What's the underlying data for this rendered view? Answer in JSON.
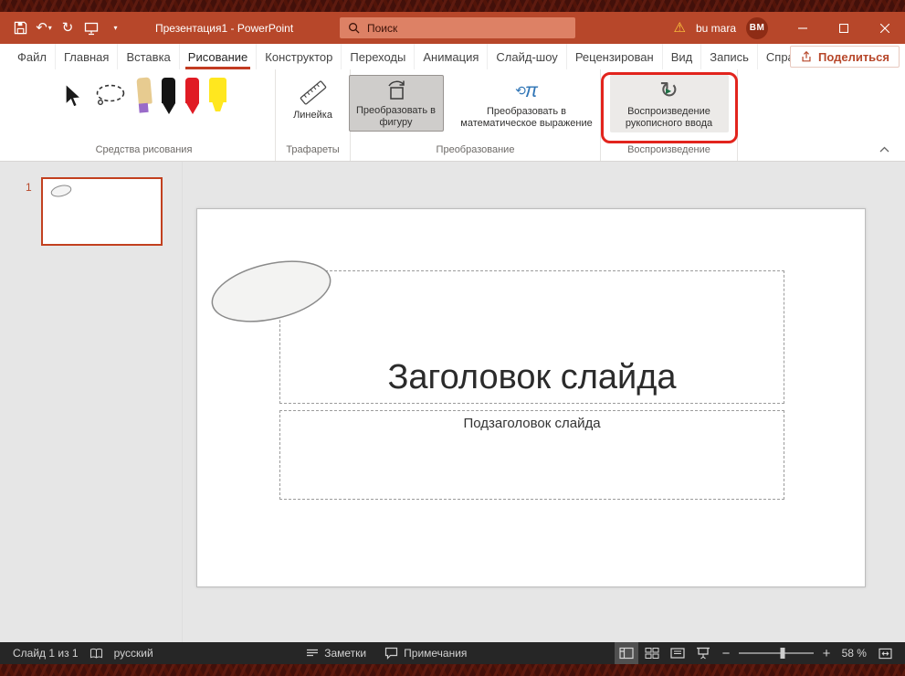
{
  "colors": {
    "titlebar": "#b7472a",
    "accent": "#c23b22",
    "annotation_red": "#e2241d",
    "selected_tool_bg": "#cfcdcb",
    "statusbar_bg": "#262626"
  },
  "titlebar": {
    "title": "Презентация1 - PowerPoint",
    "search_placeholder": "Поиск",
    "user_name": "bu mara",
    "avatar_initials": "BM"
  },
  "icons": {
    "undo": "↶",
    "redo": "↻",
    "dropdown": "▾",
    "warning": "⚠",
    "math_arc": "⟲",
    "math_pi": "π",
    "replay_arrow": "↻",
    "replay_play": "▶"
  },
  "tabs": {
    "items": [
      "Файл",
      "Главная",
      "Вставка",
      "Рисование",
      "Конструктор",
      "Переходы",
      "Анимация",
      "Слайд-шоу",
      "Рецензирован",
      "Вид",
      "Запись",
      "Справка"
    ],
    "active": "Рисование",
    "share": "Поделиться"
  },
  "ribbon": {
    "groups": [
      "Средства рисования",
      "Трафареты",
      "Преобразование",
      "Воспроизведение"
    ],
    "ruler_label": "Линейка",
    "convert_shape_label": "Преобразовать в фигуру",
    "convert_math_label": "Преобразовать в математическое выражение",
    "replay_label": "Воспроизведение рукописного ввода"
  },
  "slides_panel": {
    "slide_number": "1"
  },
  "slide": {
    "title_placeholder": "Заголовок слайда",
    "subtitle_placeholder": "Подзаголовок слайда"
  },
  "statusbar": {
    "slide_counter": "Слайд 1 из 1",
    "language": "русский",
    "notes_label": "Заметки",
    "comments_label": "Примечания",
    "zoom_minus": "−",
    "zoom_plus": "+",
    "zoom_level": "58 %"
  }
}
